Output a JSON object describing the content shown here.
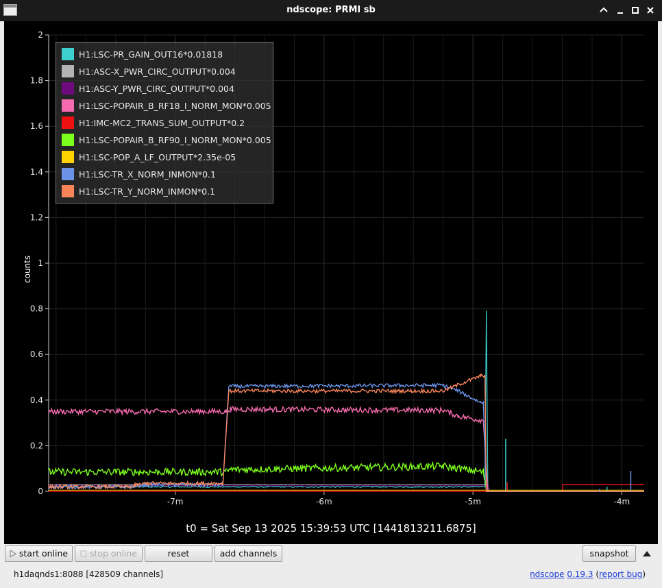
{
  "window": {
    "title": "ndscope: PRMI sb"
  },
  "plot": {
    "t0_label": "t0 = Sat Sep 13 2025 15:39:53 UTC [1441813211.6875]",
    "background": "#000000"
  },
  "legend": [
    {
      "label": "H1:LSC-PR_GAIN_OUT16*0.01818",
      "color": "#3ecfcf"
    },
    {
      "label": "H1:ASC-X_PWR_CIRC_OUTPUT*0.004",
      "color": "#b4b4b4"
    },
    {
      "label": "H1:ASC-Y_PWR_CIRC_OUTPUT*0.004",
      "color": "#6e0a7e"
    },
    {
      "label": "H1:LSC-POPAIR_B_RF18_I_NORM_MON*0.005",
      "color": "#f56aae"
    },
    {
      "label": "H1:IMC-MC2_TRANS_SUM_OUTPUT*0.2",
      "color": "#ee1111"
    },
    {
      "label": "H1:LSC-POPAIR_B_RF90_I_NORM_MON*0.005",
      "color": "#7dff1d"
    },
    {
      "label": "H1:LSC-POP_A_LF_OUTPUT*2.35e-05",
      "color": "#ffd200"
    },
    {
      "label": "H1:LSC-TR_X_NORM_INMON*0.1",
      "color": "#6b93e8"
    },
    {
      "label": "H1:LSC-TR_Y_NORM_INMON*0.1",
      "color": "#f8845a"
    }
  ],
  "toolbar": {
    "start_online": "start online",
    "stop_online": "stop online",
    "reset": "reset",
    "add_channels": "add channels",
    "snapshot": "snapshot"
  },
  "status": {
    "server": "h1daqnds1:8088  [428509 channels]",
    "app_name": "ndscope",
    "version": "0.19.3",
    "report_bug": "report bug"
  },
  "chart_data": {
    "type": "line",
    "ylabel": "counts",
    "xlabel": "",
    "ylim": [
      0,
      2
    ],
    "y_ticks": [
      0,
      0.2,
      0.4,
      0.6,
      0.8,
      1,
      1.2,
      1.4,
      1.6,
      1.8,
      2
    ],
    "x_unit": "minutes relative to t0",
    "xlim": [
      -7.85,
      -3.85
    ],
    "x_ticks": [
      {
        "value": -7,
        "label": "-7m"
      },
      {
        "value": -6,
        "label": "-6m"
      },
      {
        "value": -5,
        "label": "-5m"
      },
      {
        "value": -4,
        "label": "-4m"
      }
    ],
    "grid": true,
    "legend_position": "top-left",
    "series": [
      {
        "name": "H1:LSC-PR_GAIN_OUT16*0.01818",
        "color": "#3ecfcf",
        "width": 1.2,
        "noise": 0.003,
        "points": [
          [
            -7.85,
            0.02
          ],
          [
            -4.92,
            0.02
          ],
          [
            -4.91,
            0.79
          ],
          [
            -4.9,
            0.0
          ],
          [
            -3.85,
            0.0
          ]
        ],
        "spikes": [
          [
            -4.78,
            0.23
          ],
          [
            -4.1,
            0.02
          ]
        ]
      },
      {
        "name": "H1:ASC-X_PWR_CIRC_OUTPUT*0.004",
        "color": "#b4b4b4",
        "width": 1,
        "noise": 0.002,
        "points": [
          [
            -7.85,
            0.03
          ],
          [
            -4.9,
            0.03
          ],
          [
            -4.89,
            0.0
          ],
          [
            -3.85,
            0.0
          ]
        ]
      },
      {
        "name": "H1:ASC-Y_PWR_CIRC_OUTPUT*0.004",
        "color": "#6e0a7e",
        "width": 1,
        "noise": 0.002,
        "points": [
          [
            -7.85,
            0.025
          ],
          [
            -4.9,
            0.025
          ],
          [
            -4.89,
            0.0
          ],
          [
            -3.85,
            0.0
          ]
        ]
      },
      {
        "name": "H1:LSC-POPAIR_B_RF18_I_NORM_MON*0.005",
        "color": "#f56aae",
        "width": 1.4,
        "noise": 0.012,
        "points": [
          [
            -7.85,
            0.35
          ],
          [
            -6.66,
            0.35
          ],
          [
            -6.63,
            0.36
          ],
          [
            -5.2,
            0.355
          ],
          [
            -5.1,
            0.33
          ],
          [
            -4.93,
            0.31
          ],
          [
            -4.9,
            0.0
          ],
          [
            -3.85,
            0.0
          ]
        ]
      },
      {
        "name": "H1:IMC-MC2_TRANS_SUM_OUTPUT*0.2",
        "color": "#ee1111",
        "width": 1.4,
        "noise": 0.0,
        "points": [
          [
            -7.85,
            0.0
          ],
          [
            -4.4,
            0.0
          ],
          [
            -4.4,
            0.03
          ],
          [
            -3.85,
            0.03
          ]
        ],
        "spikes": [
          [
            -4.77,
            0.04
          ]
        ]
      },
      {
        "name": "H1:LSC-POPAIR_B_RF90_I_NORM_MON*0.005",
        "color": "#7dff1d",
        "width": 1.4,
        "noise": 0.016,
        "points": [
          [
            -7.85,
            0.085
          ],
          [
            -6.66,
            0.085
          ],
          [
            -6.63,
            0.095
          ],
          [
            -5.2,
            0.11
          ],
          [
            -4.93,
            0.085
          ],
          [
            -4.91,
            0.0
          ],
          [
            -3.85,
            0.0
          ]
        ]
      },
      {
        "name": "H1:LSC-POP_A_LF_OUTPUT*2.35e-05",
        "color": "#ffd200",
        "width": 1,
        "noise": 0.0,
        "points": [
          [
            -7.85,
            0.005
          ],
          [
            -3.85,
            0.005
          ]
        ]
      },
      {
        "name": "H1:LSC-TR_X_NORM_INMON*0.1",
        "color": "#6b93e8",
        "width": 1.4,
        "noise": 0.008,
        "points": [
          [
            -7.85,
            0.02
          ],
          [
            -7.3,
            0.02
          ],
          [
            -7.2,
            0.03
          ],
          [
            -6.68,
            0.03
          ],
          [
            -6.64,
            0.46
          ],
          [
            -5.2,
            0.465
          ],
          [
            -5.1,
            0.44
          ],
          [
            -4.95,
            0.39
          ],
          [
            -4.93,
            0.39
          ],
          [
            -4.91,
            0.0
          ],
          [
            -3.85,
            0.0
          ]
        ],
        "spikes": [
          [
            -3.94,
            0.09
          ],
          [
            -4.15,
            0.01
          ]
        ]
      },
      {
        "name": "H1:LSC-TR_Y_NORM_INMON*0.1",
        "color": "#f8845a",
        "width": 1.4,
        "noise": 0.008,
        "points": [
          [
            -7.85,
            0.02
          ],
          [
            -7.3,
            0.02
          ],
          [
            -7.2,
            0.035
          ],
          [
            -6.68,
            0.035
          ],
          [
            -6.64,
            0.44
          ],
          [
            -5.2,
            0.44
          ],
          [
            -5.05,
            0.48
          ],
          [
            -4.95,
            0.505
          ],
          [
            -4.92,
            0.51
          ],
          [
            -4.91,
            0.0
          ],
          [
            -3.85,
            0.0
          ]
        ],
        "spikes": [
          [
            -7.27,
            0.04
          ]
        ]
      }
    ]
  }
}
